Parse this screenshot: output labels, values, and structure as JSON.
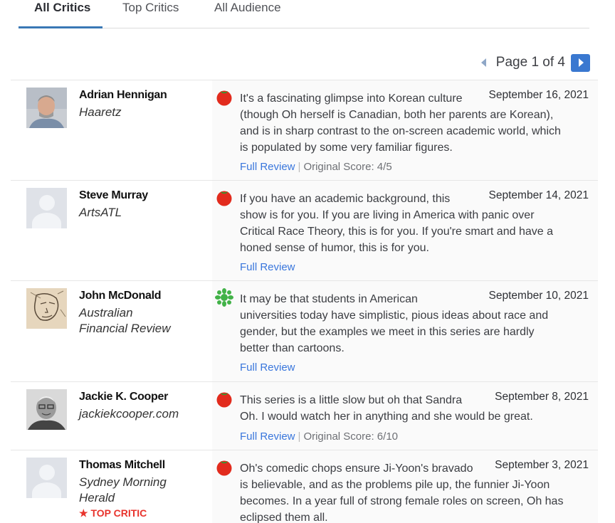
{
  "tabs": [
    {
      "label": "All Critics",
      "active": true
    },
    {
      "label": "Top Critics",
      "active": false
    },
    {
      "label": "All Audience",
      "active": false
    }
  ],
  "pagination": {
    "label": "Page 1 of 4",
    "current": 1,
    "total": 4
  },
  "colors": {
    "accent": "#3a78d0",
    "link": "#3976dc",
    "top_critic": "#e8332c",
    "fresh": "#e22b1d",
    "rotten": "#42b248"
  },
  "reviews": [
    {
      "critic": "Adrian Hennigan",
      "publication": "Haaretz",
      "avatar": "photo",
      "rating": "fresh-tomato-icon",
      "date": "September 16, 2021",
      "quote_lines": [
        "It's a fascinating glimpse into Korean culture",
        "(though Oh herself is Canadian, both her parents are Korean),",
        "and is in sharp contrast to the on-screen academic world, which",
        "is populated by some very familiar figures."
      ],
      "full_review": "Full Review",
      "original_score": "Original Score: 4/5"
    },
    {
      "critic": "Steve Murray",
      "publication": "ArtsATL",
      "avatar": "default",
      "rating": "fresh-tomato-icon",
      "date": "September 14, 2021",
      "quote_lines": [
        "If you have an academic background, this",
        "show is for you. If you are living in America with panic over",
        "Critical Race Theory, this is for you. If you're smart and have a",
        "honed sense of humor, this is for you."
      ],
      "full_review": "Full Review",
      "original_score": ""
    },
    {
      "critic": "John McDonald",
      "publication_lines": [
        "Australian",
        "Financial Review"
      ],
      "avatar": "sketch",
      "rating": "rotten-splat-icon",
      "date": "September 10, 2021",
      "quote_lines": [
        "It may be that students in American",
        "universities today have simplistic, pious ideas about race and",
        "gender, but the examples we meet in this series are hardly",
        "better than cartoons."
      ],
      "full_review": "Full Review",
      "original_score": ""
    },
    {
      "critic": "Jackie K. Cooper",
      "publication": "jackiekcooper.com",
      "avatar": "photo-bw",
      "rating": "fresh-tomato-icon",
      "date": "September 8, 2021",
      "quote_lines": [
        "This series is a little slow but oh that Sandra",
        "Oh. I would watch her in anything and she would be great."
      ],
      "full_review": "Full Review",
      "original_score": "Original Score: 6/10"
    },
    {
      "critic": "Thomas Mitchell",
      "publication_lines": [
        "Sydney Morning",
        "Herald"
      ],
      "top_critic_label": "TOP CRITIC",
      "avatar": "default",
      "rating": "fresh-tomato-icon",
      "date": "September 3, 2021",
      "quote_lines": [
        "Oh's comedic chops ensure Ji-Yoon's bravado",
        "is believable, and as the problems pile up, the funnier Ji-Yoon",
        "becomes. In a year full of strong female roles on screen, Oh has",
        "eclipsed them all."
      ]
    }
  ]
}
